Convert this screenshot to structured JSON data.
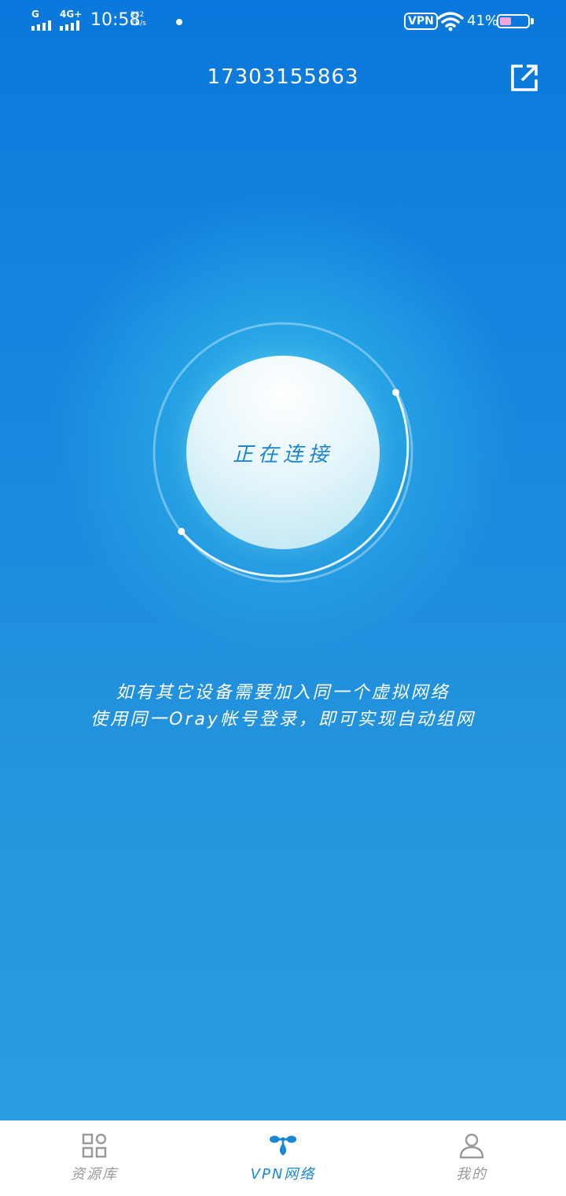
{
  "status_bar": {
    "sim1_label": "G",
    "sim2_label": "4G+",
    "time": "10:58",
    "net_speed_value": "532",
    "net_speed_unit": "KB/s",
    "vpn_badge": "VPN",
    "battery_percent": "41%",
    "battery_level": 0.41
  },
  "header": {
    "account": "17303155863",
    "share_icon": "external-link-icon"
  },
  "connect": {
    "status_label": "正在连接"
  },
  "hint": {
    "line1": "如有其它设备需要加入同一个虚拟网络",
    "line2": "使用同一Oray帐号登录，即可实现自动组网"
  },
  "nav": {
    "items": [
      {
        "label": "资源库",
        "icon": "grid-apps-icon",
        "active": false
      },
      {
        "label": "VPN网络",
        "icon": "network-nodes-icon",
        "active": true
      },
      {
        "label": "我的",
        "icon": "user-icon",
        "active": false
      }
    ]
  },
  "colors": {
    "background_top": "#0a78dc",
    "background_bottom": "#2c9fe0",
    "accent": "#1a86d6",
    "inactive": "#9a9a9a",
    "battery_fill": "#f0a6d8"
  }
}
